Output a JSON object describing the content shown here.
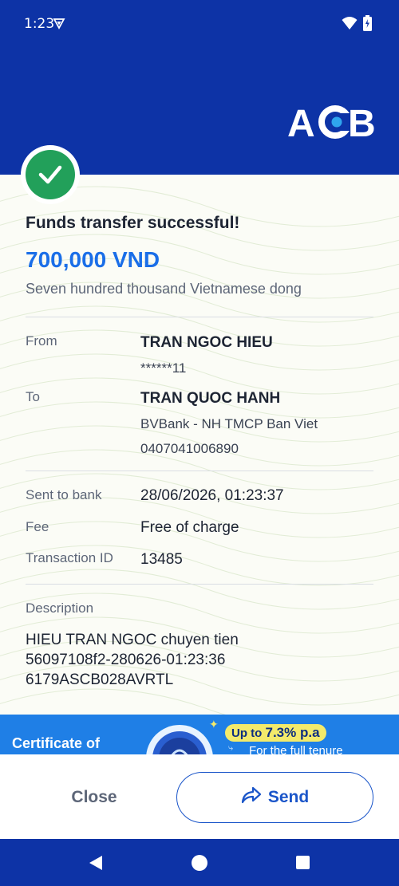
{
  "status_bar": {
    "time": "1:23"
  },
  "brand": {
    "name": "ACB"
  },
  "receipt": {
    "title": "Funds transfer successful!",
    "amount": "700,000 VND",
    "amount_in_words": "Seven hundred thousand Vietnamese dong",
    "from": {
      "label": "From",
      "name": "TRAN NGOC HIEU",
      "account": "******11"
    },
    "to": {
      "label": "To",
      "name": "TRAN QUOC HANH",
      "bank": "BVBank - NH TMCP Ban Viet",
      "account": "0407041006890"
    },
    "sent_to_bank": {
      "label": "Sent to bank",
      "value": "28/06/2026, 01:23:37"
    },
    "fee": {
      "label": "Fee",
      "value": "Free of charge"
    },
    "transaction_id": {
      "label": "Transaction ID",
      "value": "13485"
    },
    "description": {
      "label": "Description",
      "lines": [
        "HIEU TRAN NGOC chuyen tien",
        "56097108f2-280626-01:23:36",
        "6179ASCB028AVRTL"
      ]
    }
  },
  "banner": {
    "title": "Certificate of",
    "rate_prefix": "Up to ",
    "rate_value": "7.3% p.a",
    "subtitle": "For the full tenure"
  },
  "actions": {
    "close_label": "Close",
    "send_label": "Send"
  },
  "colors": {
    "brand_blue": "#0d33a6",
    "amount_blue": "#1a6ee8",
    "success_green": "#22a05a",
    "banner_blue": "#1f7fe6"
  }
}
